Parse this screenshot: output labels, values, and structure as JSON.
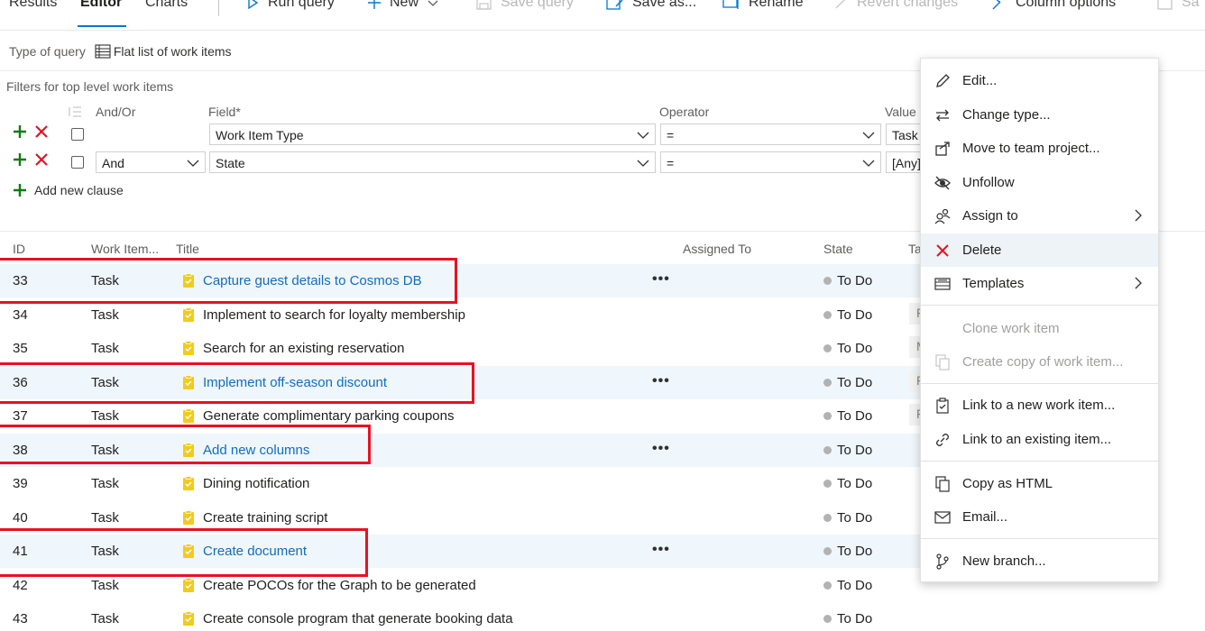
{
  "toolbar": {
    "results": "Results",
    "editor": "Editor",
    "charts": "Charts",
    "run_query": "Run query",
    "new": "New",
    "save_query": "Save query",
    "save_as": "Save as...",
    "rename": "Rename",
    "revert": "Revert changes",
    "column_options": "Column options",
    "save_stub": "Sa"
  },
  "query_type": {
    "label": "Type of query",
    "value": "Flat list of work items"
  },
  "filters": {
    "title": "Filters for top level work items",
    "headers": {
      "andor": "And/Or",
      "field": "Field*",
      "operator": "Operator",
      "value": "Value"
    },
    "clauses": [
      {
        "andor": "",
        "field": "Work Item Type",
        "operator": "=",
        "value": "Task"
      },
      {
        "andor": "And",
        "field": "State",
        "operator": "=",
        "value": "[Any]"
      }
    ],
    "add_clause": "Add new clause"
  },
  "table": {
    "headers": {
      "id": "ID",
      "type": "Work Item...",
      "title": "Title",
      "assigned": "Assigned To",
      "state": "State",
      "tags": "Ta"
    },
    "rows": [
      {
        "id": "33",
        "type": "Task",
        "title": "Capture guest details to Cosmos DB",
        "state": "To Do",
        "tag": ""
      },
      {
        "id": "34",
        "type": "Task",
        "title": "Implement to search for loyalty membership",
        "state": "To Do",
        "tag": "F"
      },
      {
        "id": "35",
        "type": "Task",
        "title": "Search for an existing reservation",
        "state": "To Do",
        "tag": "M"
      },
      {
        "id": "36",
        "type": "Task",
        "title": "Implement off-season discount",
        "state": "To Do",
        "tag": "F"
      },
      {
        "id": "37",
        "type": "Task",
        "title": "Generate complimentary parking coupons",
        "state": "To Do",
        "tag": "F"
      },
      {
        "id": "38",
        "type": "Task",
        "title": "Add new columns",
        "state": "To Do",
        "tag": ""
      },
      {
        "id": "39",
        "type": "Task",
        "title": "Dining notification",
        "state": "To Do",
        "tag": ""
      },
      {
        "id": "40",
        "type": "Task",
        "title": "Create training script",
        "state": "To Do",
        "tag": ""
      },
      {
        "id": "41",
        "type": "Task",
        "title": "Create document",
        "state": "To Do",
        "tag": ""
      },
      {
        "id": "42",
        "type": "Task",
        "title": "Create POCOs for the Graph to be generated",
        "state": "To Do",
        "tag": ""
      },
      {
        "id": "43",
        "type": "Task",
        "title": "Create console program that generate booking data",
        "state": "To Do",
        "tag": ""
      }
    ],
    "more_glyph": "•••"
  },
  "context_menu": {
    "edit": "Edit...",
    "change_type": "Change type...",
    "move": "Move to team project...",
    "unfollow": "Unfollow",
    "assign": "Assign to",
    "delete": "Delete",
    "templates": "Templates",
    "clone": "Clone work item",
    "create_copy": "Create copy of work item...",
    "link_new": "Link to a new work item...",
    "link_existing": "Link to an existing item...",
    "copy_html": "Copy as HTML",
    "email": "Email...",
    "new_branch": "New branch..."
  },
  "colors": {
    "accent": "#0078d4",
    "link": "#106ebe",
    "selected_row": "#eff6fc",
    "highlight_box": "#e81123",
    "add_green": "#107c10",
    "remove_red": "#e81123",
    "task_icon": "#f2cb1d"
  }
}
